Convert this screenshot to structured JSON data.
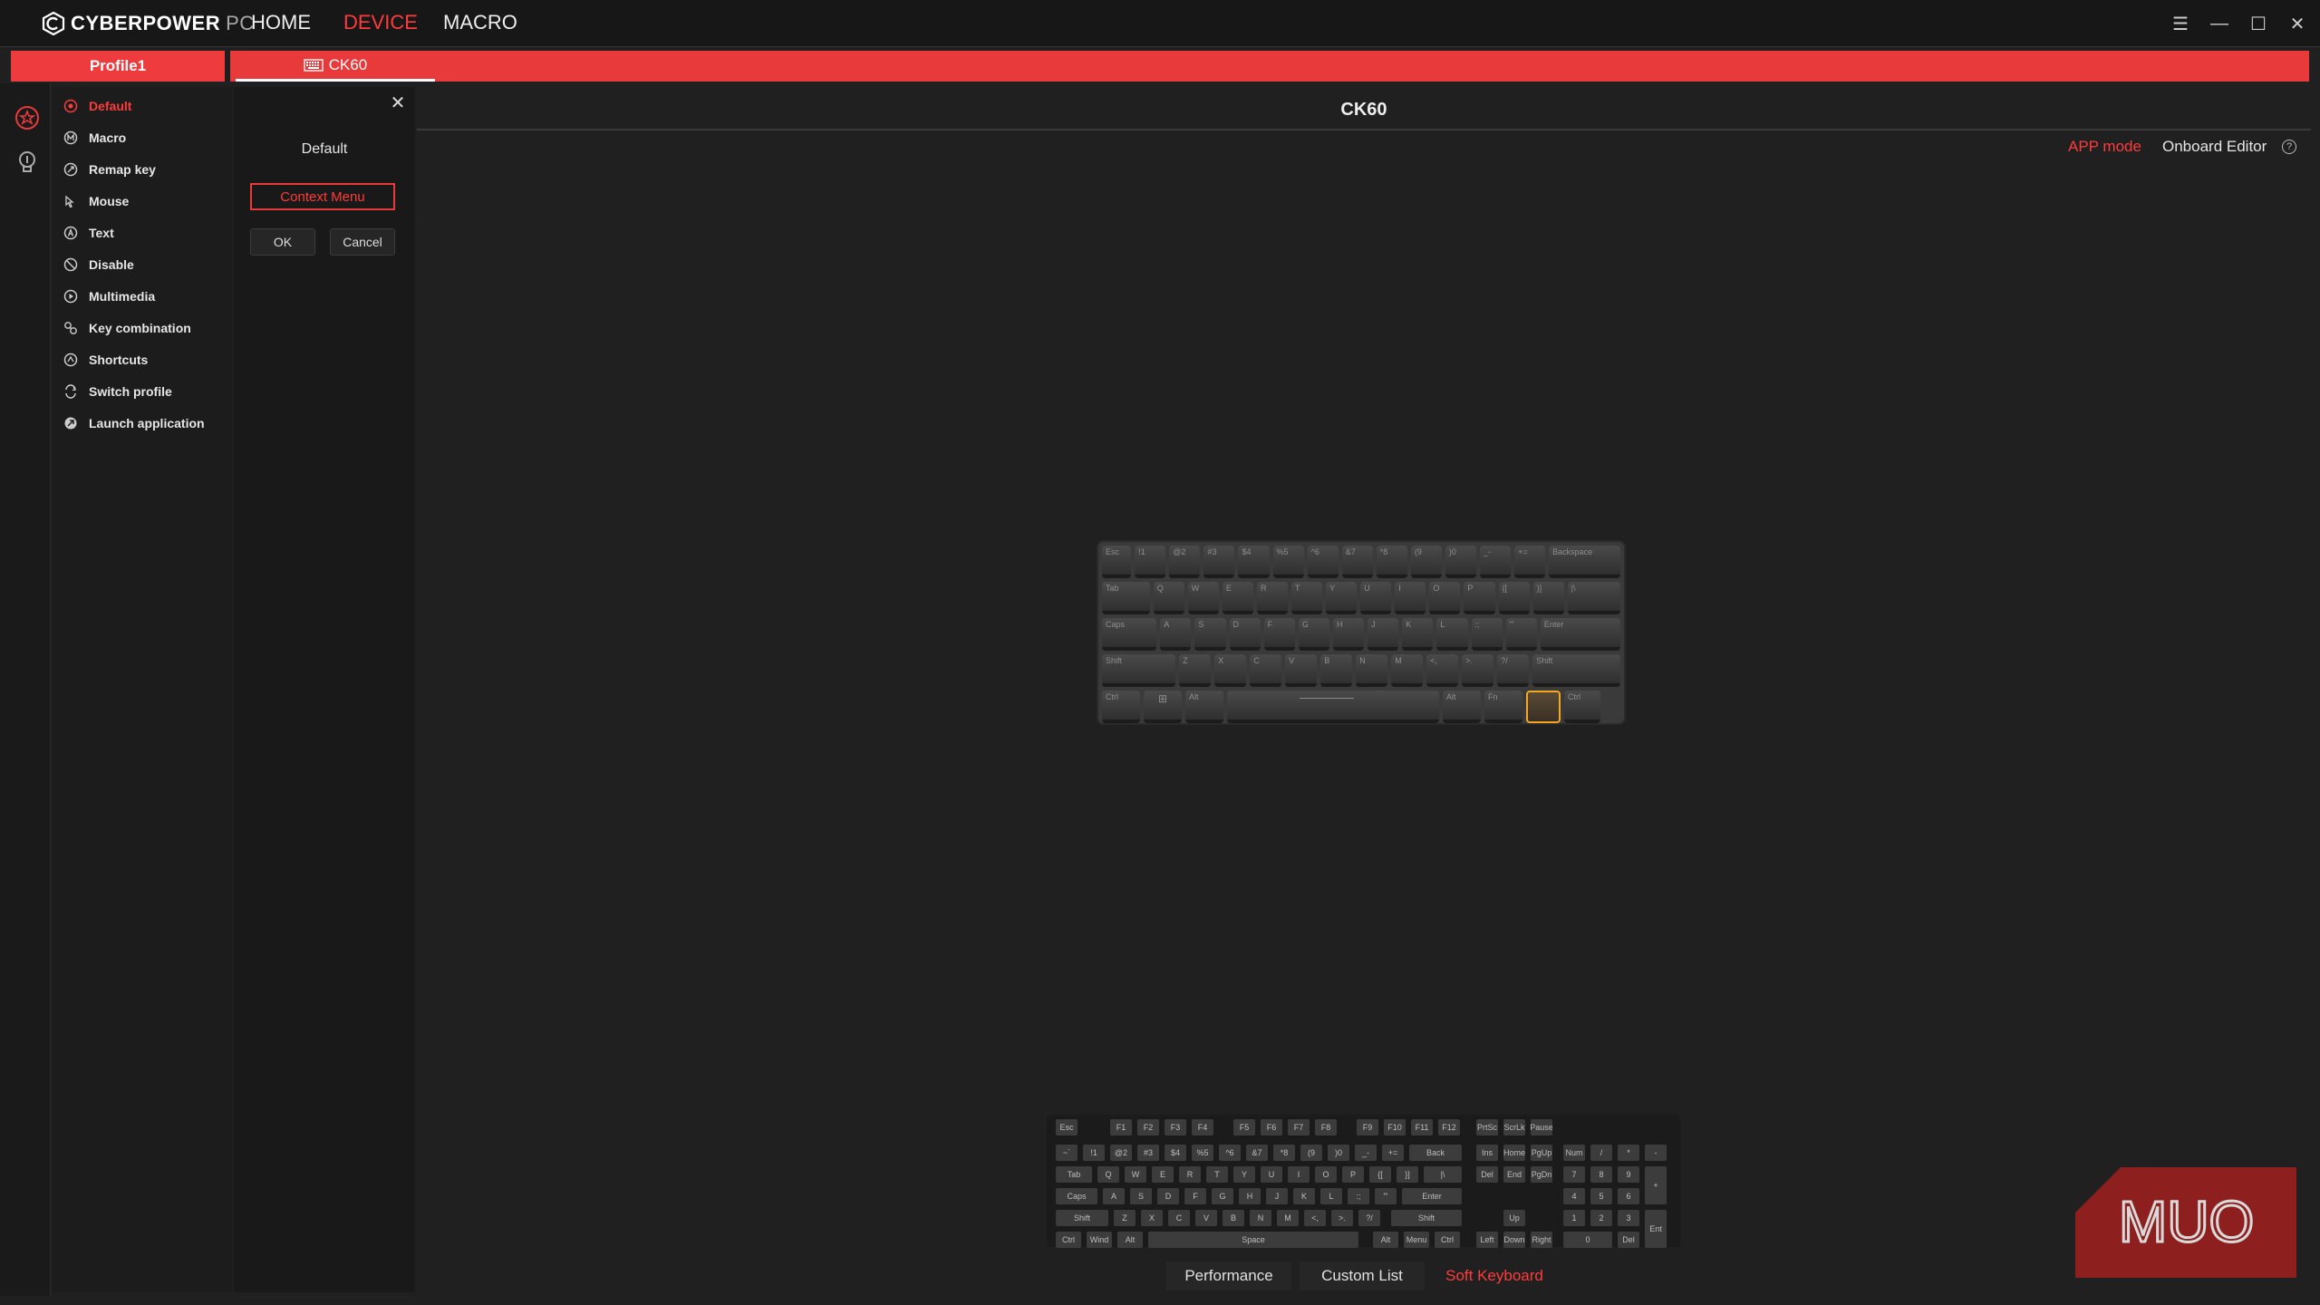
{
  "app": {
    "brand": "CYBERPOWER",
    "brand_suffix": "PC",
    "nav": [
      {
        "label": "HOME",
        "active": false
      },
      {
        "label": "DEVICE",
        "active": true
      },
      {
        "label": "MACRO",
        "active": false
      }
    ]
  },
  "profile_bar": {
    "profile": "Profile1",
    "device": "CK60"
  },
  "functions": [
    {
      "label": "Default",
      "icon": "target-icon",
      "active": true
    },
    {
      "label": "Macro",
      "icon": "macro-icon",
      "active": false
    },
    {
      "label": "Remap key",
      "icon": "remap-icon",
      "active": false
    },
    {
      "label": "Mouse",
      "icon": "mouse-icon",
      "active": false
    },
    {
      "label": "Text",
      "icon": "text-icon",
      "active": false
    },
    {
      "label": "Disable",
      "icon": "disable-icon",
      "active": false
    },
    {
      "label": "Multimedia",
      "icon": "play-icon",
      "active": false
    },
    {
      "label": "Key combination",
      "icon": "key-combination-icon",
      "active": false
    },
    {
      "label": "Shortcuts",
      "icon": "shortcuts-icon",
      "active": false
    },
    {
      "label": "Switch profile",
      "icon": "switch-profile-icon",
      "active": false
    },
    {
      "label": "Launch application",
      "icon": "launch-icon",
      "active": false
    }
  ],
  "panel": {
    "title": "Default",
    "context_button": "Context Menu",
    "ok": "OK",
    "cancel": "Cancel"
  },
  "main": {
    "device_title": "CK60",
    "mode_app": "APP mode",
    "mode_onboard": "Onboard Editor",
    "keyboard_rows": [
      [
        "Esc",
        "!1",
        "@2",
        "#3",
        "$4",
        "%5",
        "^6",
        "&7",
        "*8",
        "(9",
        ")0",
        "_-",
        "+=",
        "Backspace"
      ],
      [
        "Tab",
        "Q",
        "W",
        "E",
        "R",
        "T",
        "Y",
        "U",
        "I",
        "O",
        "P",
        "{[",
        "}]",
        "|\\"
      ],
      [
        "Caps",
        "A",
        "S",
        "D",
        "F",
        "G",
        "H",
        "J",
        "K",
        "L",
        ":;",
        "\"'",
        "Enter"
      ],
      [
        "Shift",
        "Z",
        "X",
        "C",
        "V",
        "B",
        "N",
        "M",
        "<,",
        ">.",
        "?/",
        "Shift"
      ],
      [
        "Ctrl",
        "⊞",
        "Alt",
        "",
        "Alt",
        "Fn",
        "Ctrl"
      ]
    ],
    "selected_key": "Menu"
  },
  "soft_keyboard": {
    "row0": [
      "Esc",
      "F1",
      "F2",
      "F3",
      "F4",
      "F5",
      "F6",
      "F7",
      "F8",
      "F9",
      "F10",
      "F11",
      "F12",
      "PrtSc",
      "ScrLk",
      "Pause"
    ],
    "row1": [
      "~`",
      "!1",
      "@2",
      "#3",
      "$4",
      "%5",
      "^6",
      "&7",
      "*8",
      "(9",
      ")0",
      "_-",
      "+=",
      "Back",
      "Ins",
      "Home",
      "PgUp",
      "Num",
      "/",
      "*",
      "-"
    ],
    "row2": [
      "Tab",
      "Q",
      "W",
      "E",
      "R",
      "T",
      "Y",
      "U",
      "I",
      "O",
      "P",
      "{[",
      "}]",
      "|\\",
      "Del",
      "End",
      "PgDn",
      "7",
      "8",
      "9",
      "+"
    ],
    "row3": [
      "Caps",
      "A",
      "S",
      "D",
      "F",
      "G",
      "H",
      "J",
      "K",
      "L",
      ":;",
      "\"'",
      "Enter",
      "4",
      "5",
      "6"
    ],
    "row4": [
      "Shift",
      "Z",
      "X",
      "C",
      "V",
      "B",
      "N",
      "M",
      "<,",
      ">.",
      "?/",
      "Shift",
      "Up",
      "1",
      "2",
      "3",
      "Ent"
    ],
    "row5": [
      "Ctrl",
      "Wind",
      "Alt",
      "Space",
      "Alt",
      "Menu",
      "Ctrl",
      "Left",
      "Down",
      "Right",
      "0",
      "Del"
    ]
  },
  "bottom_tabs": [
    {
      "label": "Performance",
      "active": false
    },
    {
      "label": "Custom List",
      "active": false
    },
    {
      "label": "Soft Keyboard",
      "active": true
    }
  ],
  "watermark": "MUO",
  "colors": {
    "accent": "#e8393b",
    "selected_key": "#f5a623"
  }
}
